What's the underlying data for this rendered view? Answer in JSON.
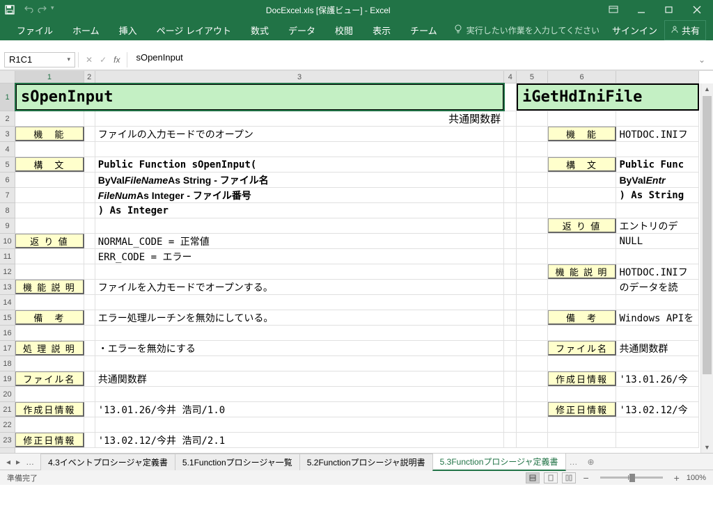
{
  "title": "DocExcel.xls  [保護ビュー] - Excel",
  "signin": "サインイン",
  "share": "共有",
  "ribbon": [
    "ファイル",
    "ホーム",
    "挿入",
    "ページ レイアウト",
    "数式",
    "データ",
    "校閲",
    "表示",
    "チーム"
  ],
  "tellme": "実行したい作業を入力してください",
  "namebox": "R1C1",
  "formula": "sOpenInput",
  "columns": [
    "1",
    "2",
    "3",
    "4",
    "5",
    "6"
  ],
  "rows": [
    "1",
    "2",
    "3",
    "4",
    "5",
    "6",
    "7",
    "8",
    "9",
    "10",
    "11",
    "12",
    "13",
    "14",
    "15",
    "16",
    "17",
    "18",
    "19",
    "20",
    "21",
    "22",
    "23"
  ],
  "doc": {
    "titleLeft": "sOpenInput",
    "titleRight": "iGetHdIniFile",
    "subRight": "共通関数群",
    "lbl_kinou": "機　能",
    "lbl_koubun": "構　文",
    "lbl_return": "返 り 値",
    "lbl_kinousetsumei": "機 能 説 明",
    "lbl_bikou": "備　考",
    "lbl_shorisetsumei": "処 理 説 明",
    "lbl_filename": "ファイル名",
    "lbl_created": "作成日情報",
    "lbl_modified": "修正日情報",
    "kinou": "ファイルの入力モードでのオープン",
    "syn1": "Public Function sOpenInput(",
    "syn2a": "  ByVal ",
    "syn2b": "FileName",
    "syn2c": "  As String  - ファイル名",
    "syn3a": "  ",
    "syn3b": "FileNum",
    "syn3c": "       As Integer - ファイル番号",
    "syn4": ") As Integer",
    "ret1": "NORMAL_CODE = 正常値",
    "ret2": "ERR_CODE    = エラー",
    "setsumei": "ファイルを入力モードでオープンする。",
    "bikou": "エラー処理ルーチンを無効にしている。",
    "shori": "・エラーを無効にする",
    "file": "共通関数群",
    "created": "'13.01.26/今井 浩司/1.0",
    "modified": "'13.02.12/今井 浩司/2.1",
    "r_kinou": "HOTDOC.INIフ",
    "r_syn1a": "Public Func",
    "r_syn2a": "  ByVal ",
    "r_syn2b": "Entr",
    "r_syn3": ") As String",
    "r_ret1": "エントリのデ",
    "r_ret2": "NULL",
    "r_setsumei1": "HOTDOC.INIフ",
    "r_setsumei2": "のデータを読",
    "r_bikou": "Windows APIを",
    "r_file": "共通関数群",
    "r_created": "'13.01.26/今",
    "r_modified": "'13.02.12/今"
  },
  "sheets": [
    "4.3イベントプロシージャ定義書",
    "5.1Functionプロシージャ一覧",
    "5.2Functionプロシージャ説明書",
    "5.3Functionプロシージャ定義書"
  ],
  "status": "準備完了",
  "zoom": "100%"
}
